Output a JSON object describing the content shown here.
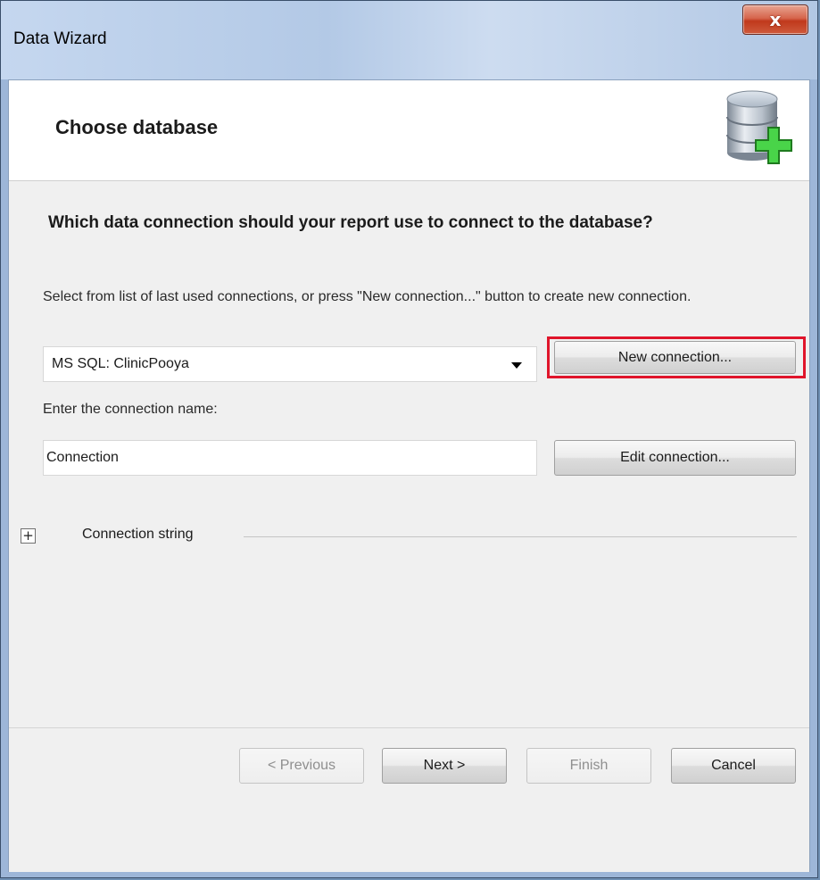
{
  "window": {
    "title": "Data Wizard",
    "close_glyph": "x"
  },
  "header": {
    "title": "Choose database",
    "icon": "database-add-icon"
  },
  "main": {
    "question": "Which data connection should your report use to connect to the database?",
    "instructions": "Select from list of last used connections, or press \"New connection...\" button to create new connection.",
    "connection_select": {
      "value": "MS SQL: ClinicPooya"
    },
    "new_connection_label": "New connection...",
    "connection_name_label": "Enter the connection name:",
    "connection_name_value": "Connection",
    "edit_connection_label": "Edit connection...",
    "connection_string": {
      "toggle": "+",
      "label": "Connection string"
    }
  },
  "footer": {
    "previous_label": "< Previous",
    "next_label": "Next >",
    "finish_label": "Finish",
    "cancel_label": "Cancel"
  },
  "colors": {
    "highlight": "#e0152b",
    "plus_green": "#3cc23c"
  }
}
